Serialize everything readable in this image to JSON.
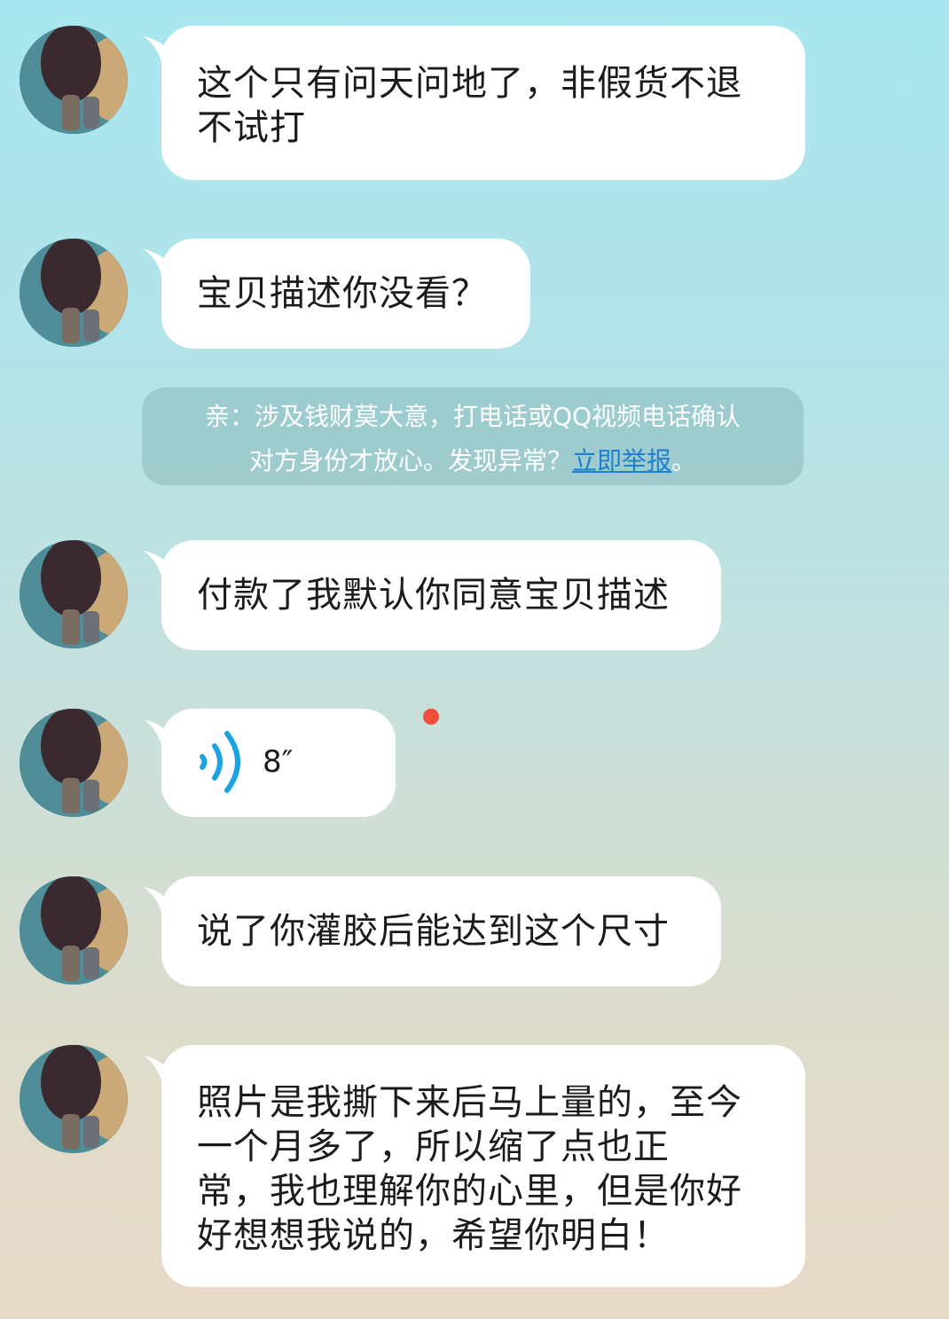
{
  "messages": [
    {
      "text": "这个只有问天问地了，非假货不退\n不试打"
    },
    {
      "text": "宝贝描述你没看？"
    },
    {
      "text": "付款了我默认你同意宝贝描述"
    },
    {
      "voice_duration": "8″"
    },
    {
      "text": "说了你灌胶后能达到这个尺寸"
    },
    {
      "text": "照片是我撕下来后马上量的，至今\n一个月多了，所以缩了点也正\n常，我也理解你的心里，但是你好\n好想想我说的，希望你明白！"
    }
  ],
  "notice": {
    "line1": "亲：涉及钱财莫大意，打电话或QQ视频电话确认",
    "line2_prefix": "对方身份才放心。发现异常？",
    "link_text": "立即举报",
    "line2_suffix": "。"
  },
  "colors": {
    "bubble": "#ffffff",
    "voice_icon": "#1aa3e0",
    "unread_dot": "#f0503a",
    "link": "#1f7fd0"
  },
  "icons": {
    "avatar": "table-tennis-paddles-avatar",
    "voice": "voice-wave-icon"
  }
}
